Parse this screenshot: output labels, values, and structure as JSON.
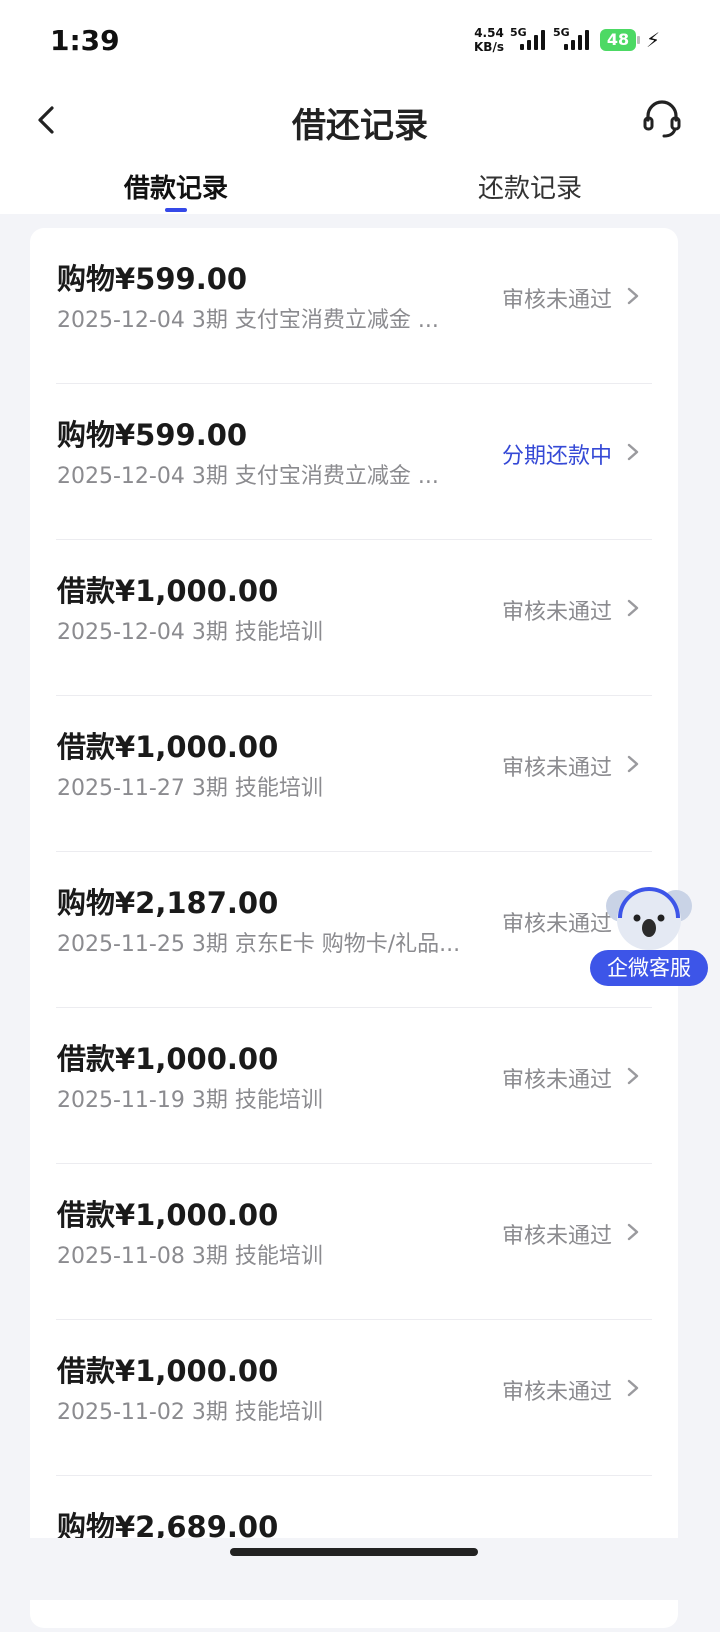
{
  "status_bar": {
    "time": "1:39",
    "net_speed_value": "4.54",
    "net_speed_unit": "KB/s",
    "signal1_label": "5G",
    "signal2_label": "5G",
    "battery": "48"
  },
  "header": {
    "title": "借还记录"
  },
  "tabs": [
    {
      "label": "借款记录",
      "active": true
    },
    {
      "label": "还款记录",
      "active": false
    }
  ],
  "records": [
    {
      "amount": "购物¥599.00",
      "meta": "2025-12-04 3期  支付宝消费立减金 ...",
      "status": "审核未通过"
    },
    {
      "amount": "购物¥599.00",
      "meta": "2025-12-04 3期  支付宝消费立减金 ...",
      "status": "分期还款中"
    },
    {
      "amount": "借款¥1,000.00",
      "meta": "2025-12-04 3期  技能培训",
      "status": "审核未通过"
    },
    {
      "amount": "借款¥1,000.00",
      "meta": "2025-11-27 3期  技能培训",
      "status": "审核未通过"
    },
    {
      "amount": "购物¥2,187.00",
      "meta": "2025-11-25 3期  京东E卡 购物卡/礼品...",
      "status": "审核未通过"
    },
    {
      "amount": "借款¥1,000.00",
      "meta": "2025-11-19 3期  技能培训",
      "status": "审核未通过"
    },
    {
      "amount": "借款¥1,000.00",
      "meta": "2025-11-08 3期  技能培训",
      "status": "审核未通过"
    },
    {
      "amount": "借款¥1,000.00",
      "meta": "2025-11-02 3期  技能培训",
      "status": "审核未通过"
    },
    {
      "amount": "购物¥2,689.00",
      "meta": "",
      "status": ""
    }
  ],
  "float_button": {
    "label": "企微客服"
  },
  "colors": {
    "accent": "#3549e8",
    "status_gray": "#8b8b8f",
    "page_bg": "#f3f4f8"
  }
}
